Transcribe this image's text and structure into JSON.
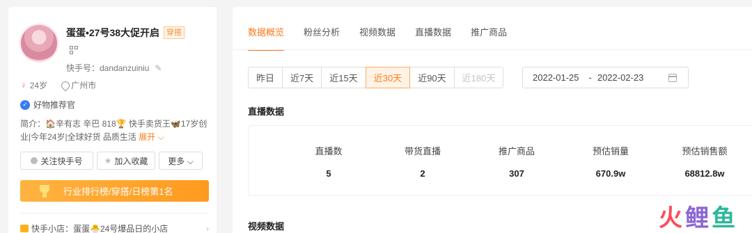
{
  "profile": {
    "name": "蛋蛋•27号38大促开启",
    "category_tag": "穿搭",
    "kuaishou_id": "快手号：dandanzuiniu",
    "age": "24岁",
    "city": "广州市",
    "badge": "好物推荐官",
    "bio": "简介：🏠辛有志 辛巴 818🏆 快手卖货王🦋17岁创业|今年24岁|全球好货 品质生活",
    "bio_expand": "展开 ⌵",
    "buttons": {
      "follow": "关注快手号",
      "collect": "加入收藏",
      "more": "更多 ⌵"
    },
    "ranking": "行业排行榜/穿搭/日榜第1名",
    "shop": "快手小店：蛋蛋🐣24号爆品日的小店"
  },
  "tabs": [
    "数据概览",
    "粉丝分析",
    "视频数据",
    "直播数据",
    "推广商品"
  ],
  "active_tab": "数据概览",
  "ranges": [
    {
      "label": "昨日",
      "state": "normal"
    },
    {
      "label": "近7天",
      "state": "normal"
    },
    {
      "label": "近15天",
      "state": "normal"
    },
    {
      "label": "近30天",
      "state": "active"
    },
    {
      "label": "近90天",
      "state": "normal"
    },
    {
      "label": "近180天",
      "state": "disabled"
    }
  ],
  "date_range": {
    "start": "2022-01-25",
    "separator": "-",
    "end": "2022-02-23"
  },
  "live_section": {
    "title": "直播数据",
    "stats": [
      {
        "label": "直播数",
        "value": "5"
      },
      {
        "label": "带货直播",
        "value": "2"
      },
      {
        "label": "推广商品",
        "value": "307"
      },
      {
        "label": "预估销量",
        "value": "670.9w"
      },
      {
        "label": "预估销售额",
        "value": "68812.8w"
      }
    ]
  },
  "video_section": {
    "title": "视频数据"
  },
  "watermark": [
    "火",
    "鲤",
    "鱼"
  ],
  "colors": {
    "accent": "#ff7a1a",
    "rank_gradient_start": "#ffb340",
    "rank_gradient_end": "#ff9a1f",
    "badge_blue": "#3a7bf5"
  }
}
